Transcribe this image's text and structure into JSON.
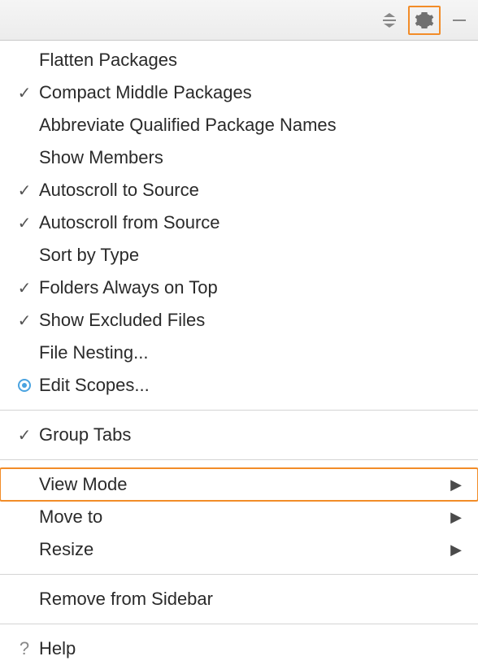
{
  "menu": {
    "groups": [
      [
        {
          "label": "Flatten Packages",
          "indicator": "none",
          "submenu": false
        },
        {
          "label": "Compact Middle Packages",
          "indicator": "check",
          "submenu": false
        },
        {
          "label": "Abbreviate Qualified Package Names",
          "indicator": "none",
          "submenu": false
        },
        {
          "label": "Show Members",
          "indicator": "none",
          "submenu": false
        },
        {
          "label": "Autoscroll to Source",
          "indicator": "check",
          "submenu": false
        },
        {
          "label": "Autoscroll from Source",
          "indicator": "check",
          "submenu": false
        },
        {
          "label": "Sort by Type",
          "indicator": "none",
          "submenu": false
        },
        {
          "label": "Folders Always on Top",
          "indicator": "check",
          "submenu": false
        },
        {
          "label": "Show Excluded Files",
          "indicator": "check",
          "submenu": false
        },
        {
          "label": "File Nesting...",
          "indicator": "none",
          "submenu": false
        },
        {
          "label": "Edit Scopes...",
          "indicator": "radio",
          "submenu": false
        }
      ],
      [
        {
          "label": "Group Tabs",
          "indicator": "check",
          "submenu": false
        }
      ],
      [
        {
          "label": "View Mode",
          "indicator": "none",
          "submenu": true,
          "highlighted": true
        },
        {
          "label": "Move to",
          "indicator": "none",
          "submenu": true
        },
        {
          "label": "Resize",
          "indicator": "none",
          "submenu": true
        }
      ],
      [
        {
          "label": "Remove from Sidebar",
          "indicator": "none",
          "submenu": false
        }
      ],
      [
        {
          "label": "Help",
          "indicator": "help",
          "submenu": false
        }
      ]
    ]
  },
  "colors": {
    "highlight": "#F28C28"
  }
}
